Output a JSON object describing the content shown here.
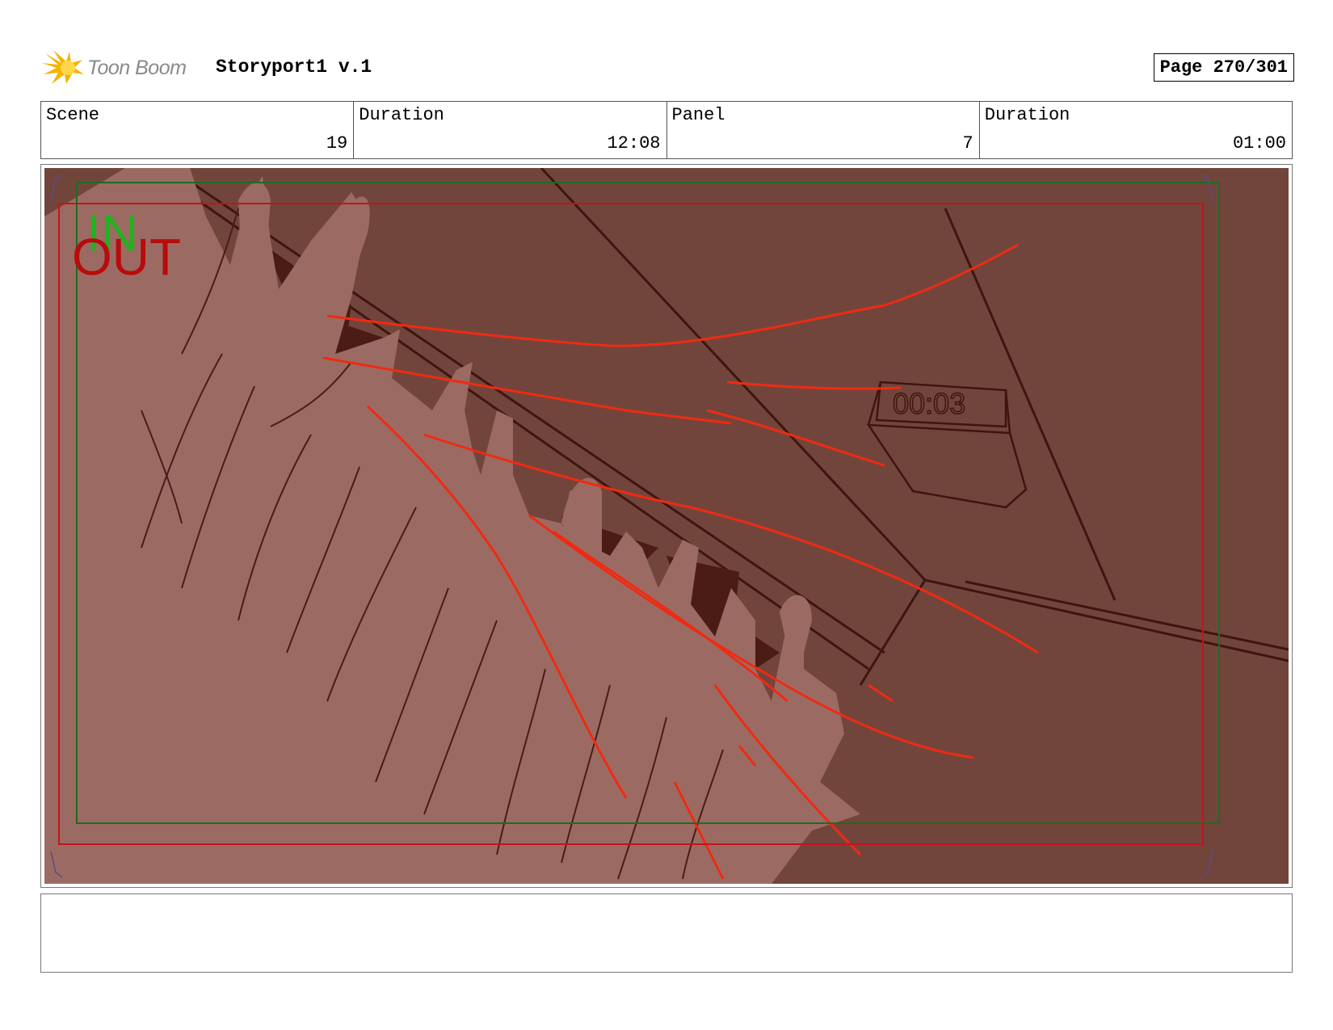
{
  "header": {
    "logo_text": "Toon Boom",
    "project_title": "Storyport1 v.1",
    "page_label": "Page 270/301"
  },
  "info": {
    "scene_label": "Scene",
    "scene_value": "19",
    "scene_duration_label": "Duration",
    "scene_duration_value": "12:08",
    "panel_label": "Panel",
    "panel_value": "7",
    "panel_duration_label": "Duration",
    "panel_duration_value": "01:00"
  },
  "panel": {
    "in_marker": "IN",
    "out_marker": "OUT",
    "clock_text": "00:03"
  },
  "colors": {
    "background": "#72453c",
    "hand_skin": "#9b6b63",
    "dark_shadow": "#4a1c15",
    "sketch_red": "#f02a12",
    "safe_green": "#1f6b1f",
    "frame_red": "#c4141c"
  },
  "notes": {
    "text": ""
  }
}
